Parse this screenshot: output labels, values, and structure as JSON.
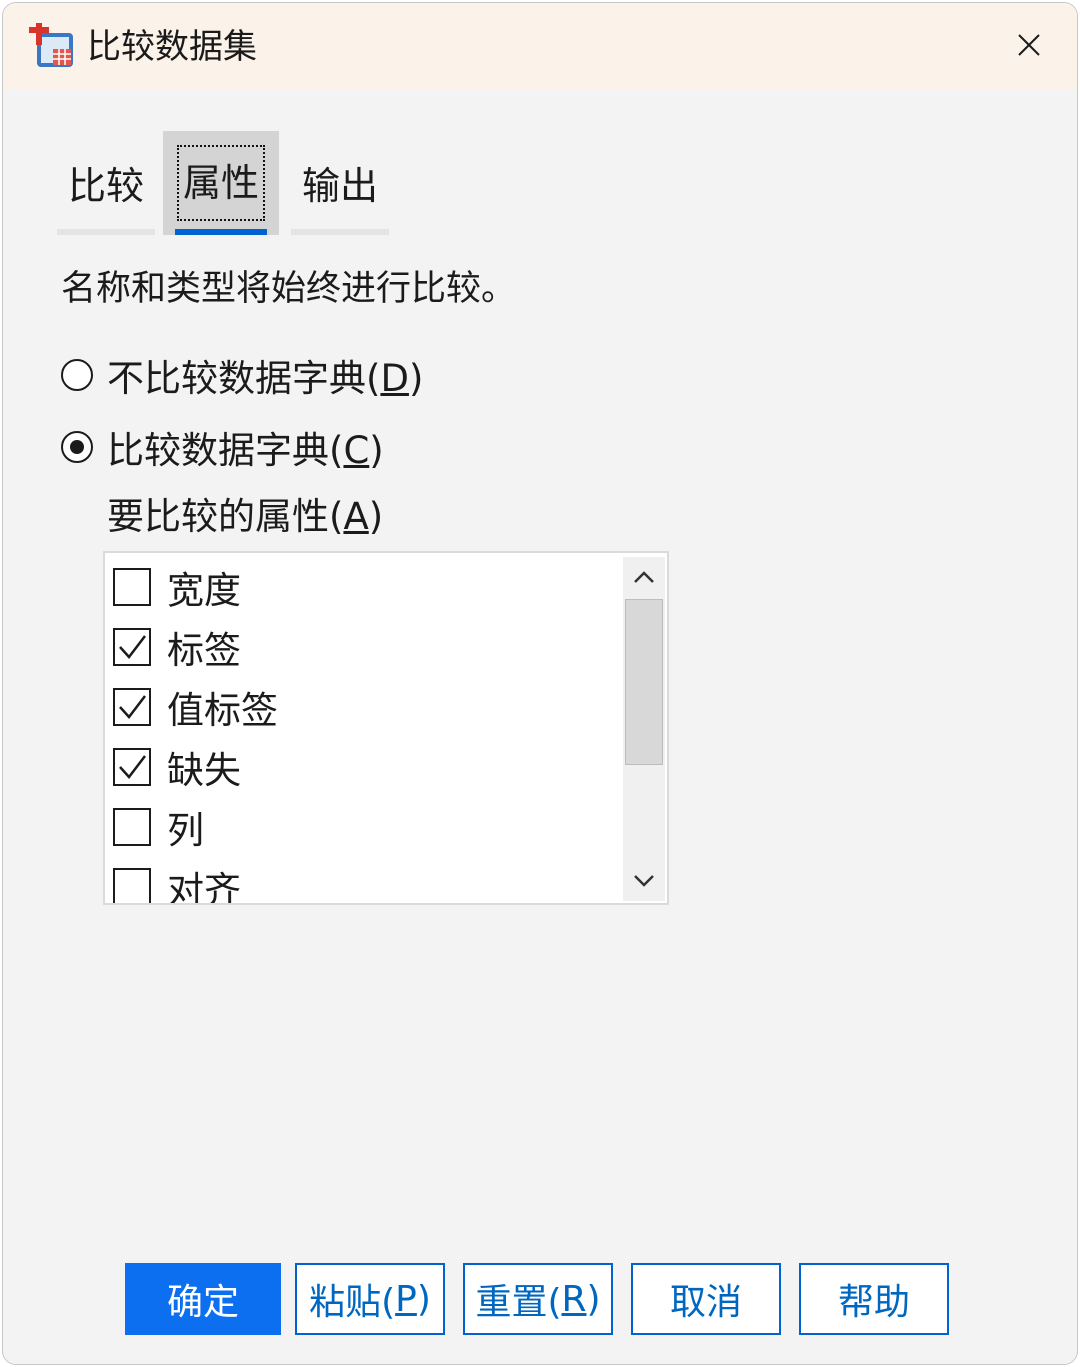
{
  "window": {
    "title": "比较数据集",
    "close_icon": "close-icon"
  },
  "tabs": [
    {
      "label": "比较",
      "active": false
    },
    {
      "label": "属性",
      "active": true
    },
    {
      "label": "输出",
      "active": false
    }
  ],
  "info_text": "名称和类型将始终进行比较。",
  "radios": [
    {
      "label": "不比较数据字典(",
      "mnemonic": "D",
      "close": ")",
      "checked": false
    },
    {
      "label": "比较数据字典(",
      "mnemonic": "C",
      "close": ")",
      "checked": true
    }
  ],
  "attributes_label": {
    "text": "要比较的属性(",
    "mnemonic": "A",
    "close": ")"
  },
  "attributes": [
    {
      "label": "宽度",
      "checked": false
    },
    {
      "label": "标签",
      "checked": true
    },
    {
      "label": "值标签",
      "checked": true
    },
    {
      "label": "缺失",
      "checked": true
    },
    {
      "label": "列",
      "checked": false
    },
    {
      "label": "对齐",
      "checked": false
    }
  ],
  "buttons": {
    "ok": "确定",
    "paste": {
      "text": "粘贴(",
      "mnemonic": "P",
      "close": ")"
    },
    "reset": {
      "text": "重置(",
      "mnemonic": "R",
      "close": ")"
    },
    "cancel": "取消",
    "help": "帮助"
  },
  "colors": {
    "accent": "#0b6ff0",
    "titlebar": "#fbf3ea",
    "dialog_bg": "#f3f3f3"
  }
}
